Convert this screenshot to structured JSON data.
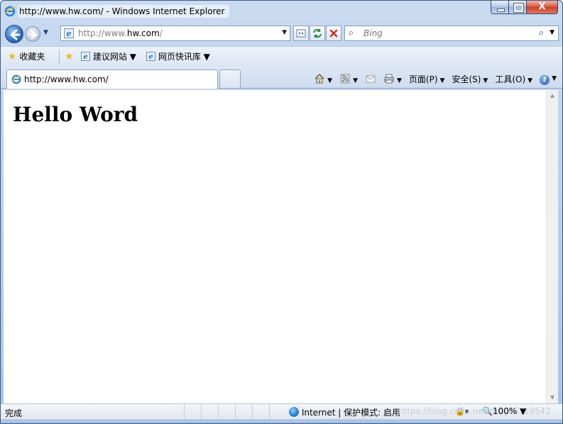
{
  "window": {
    "title": "http://www.hw.com/ - Windows Internet Explorer",
    "close_glyph": "X"
  },
  "address_bar": {
    "url_prefix": "http://www.",
    "url_domain": "hw.com",
    "url_suffix": "/"
  },
  "search": {
    "placeholder": "Bing"
  },
  "favorites_bar": {
    "favorites_label": "收藏夹",
    "suggested_sites_label": "建议网站 ▼",
    "web_slice_gallery_label": "网页快讯库 ▼"
  },
  "tabs": [
    {
      "label": "http://www.hw.com/"
    }
  ],
  "command_bar": {
    "page_label": "页面(P)",
    "safety_label": "安全(S)",
    "tools_label": "工具(O)",
    "help_glyph": "?"
  },
  "content": {
    "heading": "Hello Word"
  },
  "status_bar": {
    "status_text": "完成",
    "zone_text": "Internet | 保护模式: 启用",
    "watermark_text": "https://blog.csdn.net/m0_46119542",
    "zoom_text": "100%"
  },
  "icons": {
    "browser": "ie-icon",
    "back": "back-arrow-icon",
    "forward": "forward-arrow-icon",
    "refresh": "refresh-icon",
    "stop": "stop-icon",
    "compat": "compatibility-view-icon",
    "search": "search-icon",
    "favorites": "star-icon",
    "home": "home-icon",
    "feeds": "feeds-icon",
    "mail": "mail-icon",
    "print": "print-icon",
    "help": "help-icon",
    "globe": "globe-icon"
  },
  "colors": {
    "frame": "#a9c3e6",
    "close_button": "#c9432d",
    "link_blue": "#1f4b8a"
  }
}
